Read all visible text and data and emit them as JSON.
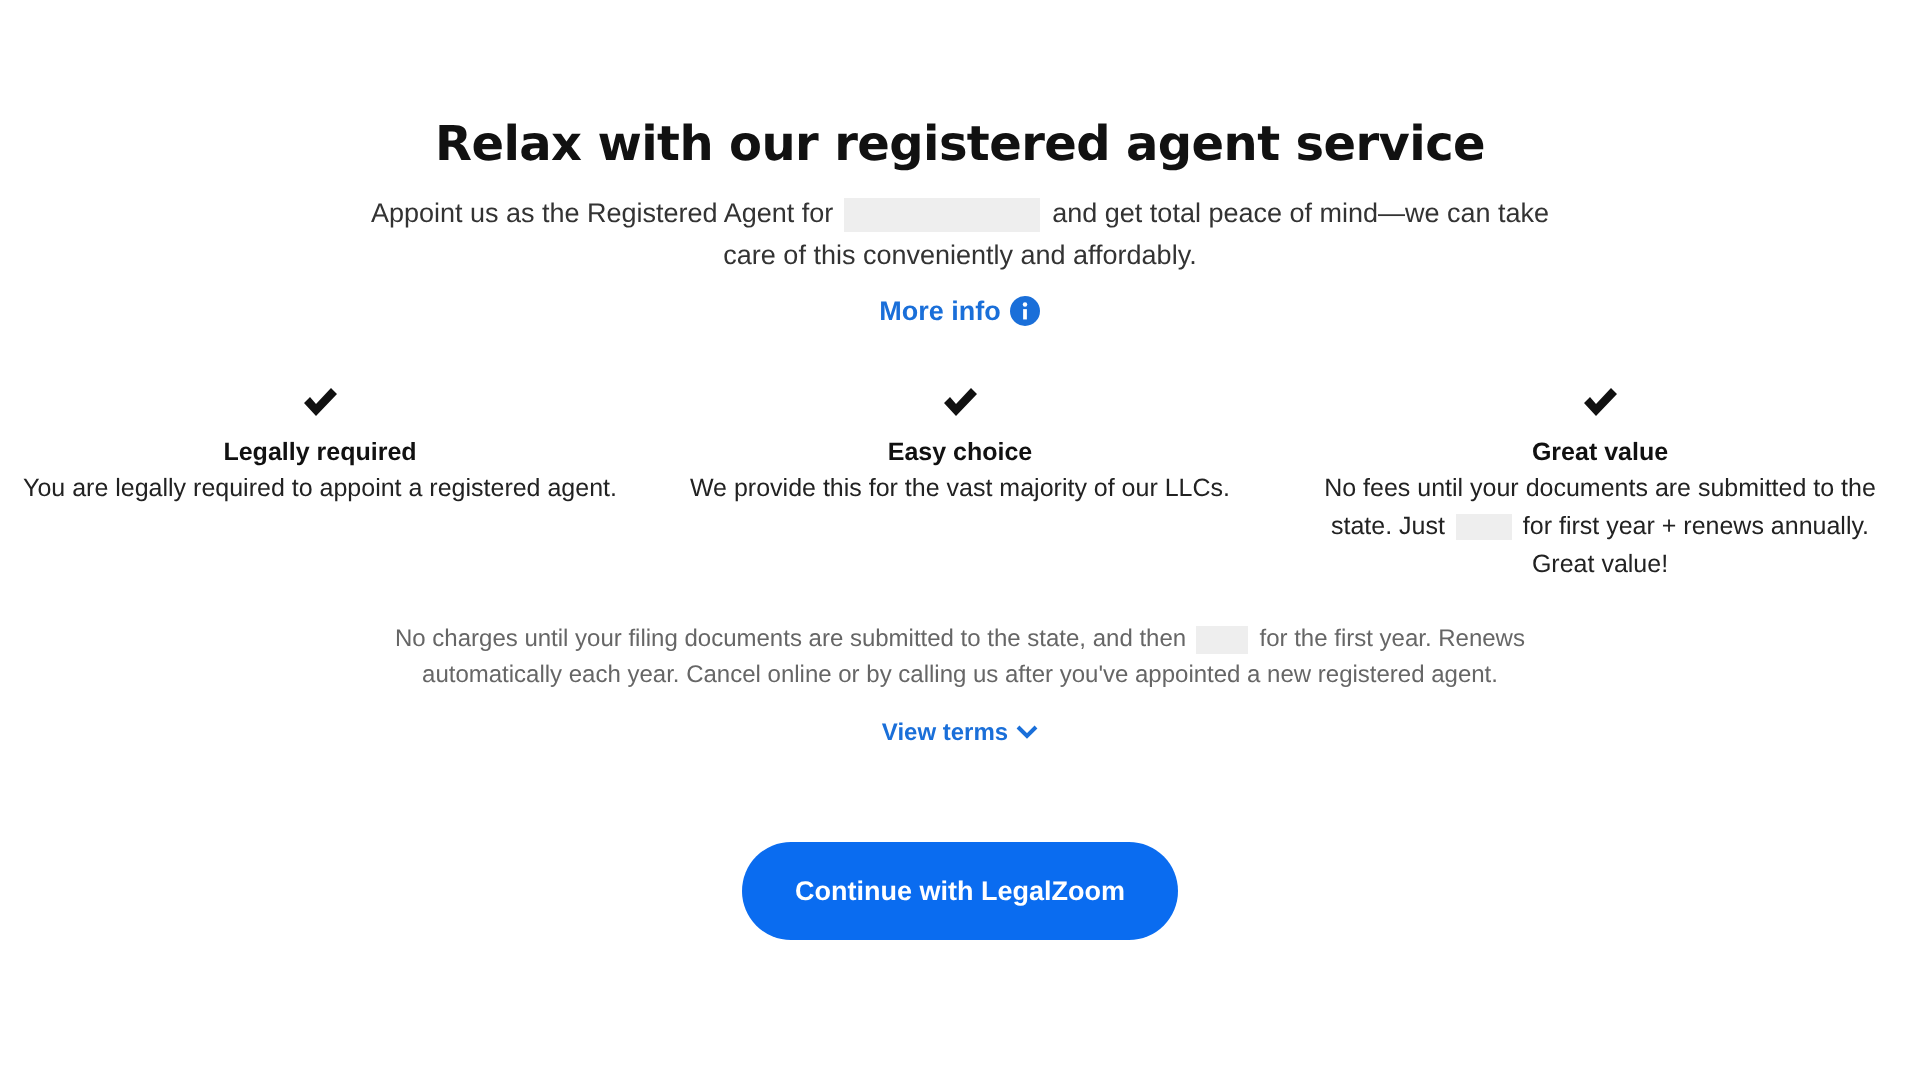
{
  "title": "Relax with our registered agent service",
  "intro": {
    "before": "Appoint us as the Registered Agent for",
    "after": "and get total peace of mind—we can take care of this conveniently and affordably."
  },
  "more_info": {
    "label": "More info"
  },
  "features": [
    {
      "title": "Legally required",
      "text_before": "You are legally required to appoint a registered agent."
    },
    {
      "title": "Easy choice",
      "text_before": "We provide this for the vast majority of our LLCs."
    },
    {
      "title": "Great value",
      "text_before": "No fees until your documents are submitted to the state. Just",
      "text_after": "for first year + renews annually. Great value!"
    }
  ],
  "terms": {
    "before": "No charges until your filing documents are submitted to the state, and then",
    "after": "for the first year. Renews automatically each year. Cancel online or by calling us after you've appointed a new registered agent.",
    "link": "View terms"
  },
  "button": {
    "label": "Continue with LegalZoom"
  }
}
